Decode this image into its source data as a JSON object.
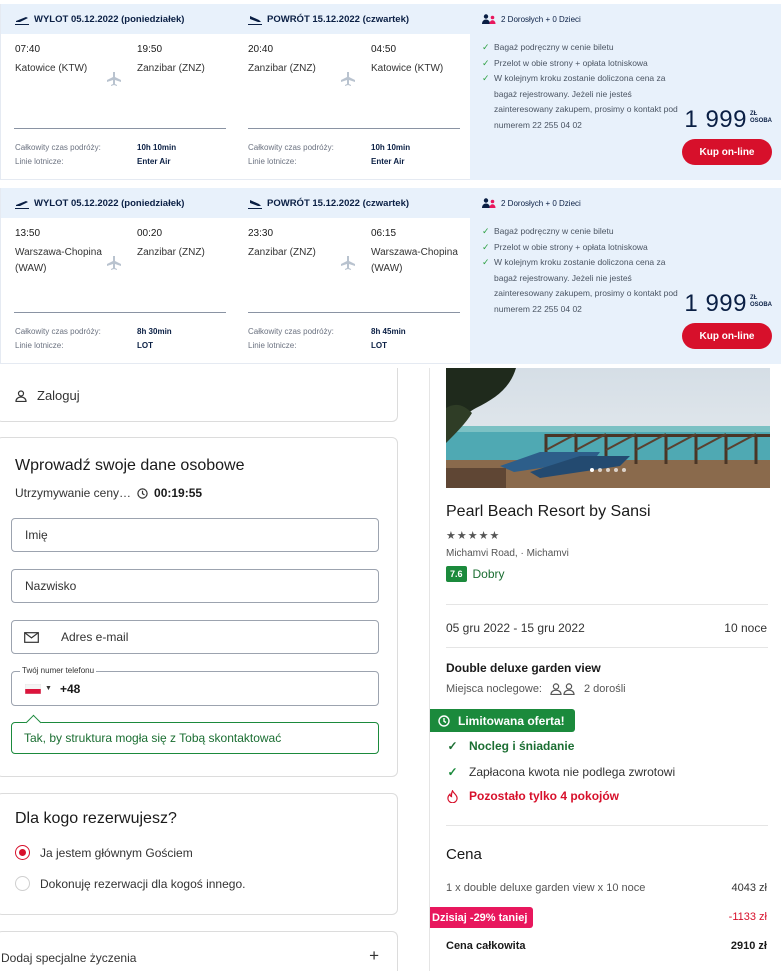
{
  "flights": [
    {
      "outbound_label": "WYLOT 05.12.2022 (poniedziałek)",
      "return_label": "POWRÓT 15.12.2022 (czwartek)",
      "out_dep_time": "07:40",
      "out_dep_city": "Katowice (KTW)",
      "out_arr_time": "19:50",
      "out_arr_city": "Zanzibar (ZNZ)",
      "ret_dep_time": "20:40",
      "ret_dep_city": "Zanzibar (ZNZ)",
      "ret_arr_time": "04:50",
      "ret_arr_city": "Katowice (KTW)",
      "total_label": "Całkowity czas podróży:",
      "airline_label": "Linie lotnicze:",
      "out_duration": "10h 10min",
      "out_airline": "Enter Air",
      "ret_duration": "10h 10min",
      "ret_airline": "Enter Air",
      "pax": "2 Dorosłych + 0 Dzieci",
      "features": [
        "Bagaż podręczny w cenie biletu",
        "Przelot w obie strony + opłata lotniskowa",
        "W kolejnym kroku zostanie doliczona cena za bagaż rejestrowany. Jeżeli nie jesteś zainteresowany zakupem, prosimy o kontakt pod numerem 22 255 04 02"
      ],
      "price": "1 999",
      "currency": "ZŁ",
      "per": "OSOBA",
      "buy_label": "Kup on-line"
    },
    {
      "outbound_label": "WYLOT 05.12.2022 (poniedziałek)",
      "return_label": "POWRÓT 15.12.2022 (czwartek)",
      "out_dep_time": "13:50",
      "out_dep_city": "Warszawa-Chopina (WAW)",
      "out_arr_time": "00:20",
      "out_arr_city": "Zanzibar (ZNZ)",
      "ret_dep_time": "23:30",
      "ret_dep_city": "Zanzibar (ZNZ)",
      "ret_arr_time": "06:15",
      "ret_arr_city": "Warszawa-Chopina (WAW)",
      "total_label": "Całkowity czas podróży:",
      "airline_label": "Linie lotnicze:",
      "out_duration": "8h 30min",
      "out_airline": "LOT",
      "ret_duration": "8h 45min",
      "ret_airline": "LOT",
      "pax": "2 Dorosłych + 0 Dzieci",
      "features": [
        "Bagaż podręczny w cenie biletu",
        "Przelot w obie strony + opłata lotniskowa",
        "W kolejnym kroku zostanie doliczona cena za bagaż rejestrowany. Jeżeli nie jesteś zainteresowany zakupem, prosimy o kontakt pod numerem 22 255 04 02"
      ],
      "price": "1 999",
      "currency": "ZŁ",
      "per": "OSOBA",
      "buy_label": "Kup on-line"
    }
  ],
  "login": {
    "label": "Zaloguj"
  },
  "personal": {
    "title": "Wprowadź swoje dane osobowe",
    "hold_label": "Utrzymywanie ceny…",
    "timer": "00:19:55",
    "first_name_placeholder": "Imię",
    "last_name_placeholder": "Nazwisko",
    "email_placeholder": "Adres e-mail",
    "phone_label": "Twój numer telefonu",
    "phone_code": "+48",
    "tip": "Tak, by struktura mogła się z Tobą skontaktować"
  },
  "booking_for": {
    "title": "Dla kogo rezerwujesz?",
    "option_main": "Ja jestem głównym Gościem",
    "option_other": "Dokonuję rezerwacji dla kogoś innego."
  },
  "wishes": {
    "label": "Dodaj specjalne życzenia",
    "plus": "+"
  },
  "hotel": {
    "name": "Pearl Beach Resort by Sansi",
    "stars": "★★★★★",
    "address": "Michamvi Road, · Michamvi",
    "score": "7.6",
    "score_word": "Dobry",
    "dates": "05 gru 2022 - 15 gru 2022",
    "nights": "10 noce",
    "room": "Double deluxe garden view",
    "beds_label": "Miejsca noclegowe:",
    "beds_value": "2 dorośli",
    "limited": "Limitowana oferta!",
    "perk_breakfast": "Nocleg i śniadanie",
    "perk_refund": "Zapłacona kwota nie podlega zwrotowi",
    "perk_rooms": "Pozostało tylko 4 pokojów"
  },
  "price_box": {
    "title": "Cena",
    "line_label": "1 x double deluxe garden view x 10 noce",
    "line_value": "4043 zł",
    "discount_label": "Dzisiaj -29% taniej",
    "discount_value": "-1133 zł",
    "total_label": "Cena całkowita",
    "total_value": "2910 zł"
  },
  "colors": {
    "accent_red": "#d7102b",
    "green": "#1b8a3c",
    "navy": "#0a1f44",
    "light_blue": "#e8f1fb",
    "pink": "#e8175d"
  }
}
